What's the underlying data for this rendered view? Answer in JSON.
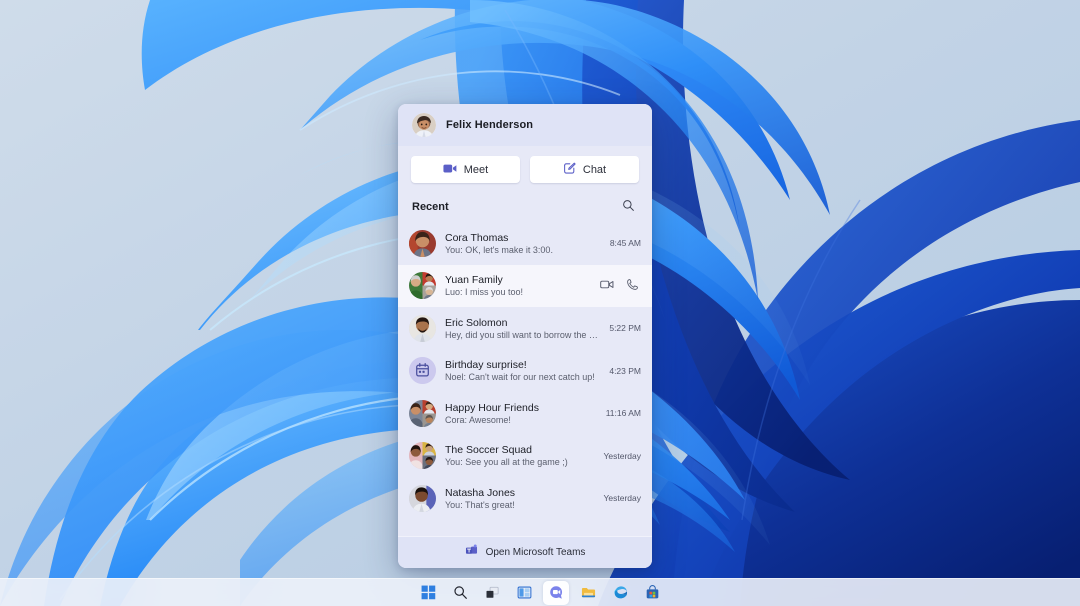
{
  "desktop": {
    "wallpaper_name": "windows-11-bloom-wallpaper",
    "colors": {
      "background_top": "#c9d9e8",
      "background_bottom": "#b9cee3",
      "ribbon_light_blue": "#3fa0fb",
      "ribbon_mid_blue": "#1a72ef",
      "ribbon_deep_blue": "#0b46c8",
      "ribbon_navy": "#0a2f9e"
    }
  },
  "taskbar": {
    "background": "#ecf1f9",
    "items": [
      {
        "name": "start-button",
        "icon": "windows-logo-icon",
        "label": "Start",
        "active": false
      },
      {
        "name": "search-button",
        "icon": "search-icon",
        "label": "Search",
        "active": false
      },
      {
        "name": "task-view-button",
        "icon": "task-view-icon",
        "label": "Task View",
        "active": false
      },
      {
        "name": "widgets-button",
        "icon": "widgets-icon",
        "label": "Widgets",
        "active": false
      },
      {
        "name": "chat-button",
        "icon": "chat-bubble-icon",
        "label": "Chat",
        "active": true
      },
      {
        "name": "file-explorer-button",
        "icon": "folder-icon",
        "label": "File Explorer",
        "active": false
      },
      {
        "name": "edge-button",
        "icon": "edge-icon",
        "label": "Microsoft Edge",
        "active": false
      },
      {
        "name": "microsoft-store-button",
        "icon": "store-bag-icon",
        "label": "Microsoft Store",
        "active": false
      }
    ]
  },
  "flyout": {
    "header": {
      "user_name": "Felix Henderson",
      "avatar": "felix-henderson-avatar"
    },
    "actions": [
      {
        "name": "meet-button",
        "label": "Meet",
        "icon": "video-camera-filled-icon"
      },
      {
        "name": "chat-button",
        "label": "Chat",
        "icon": "compose-chat-icon"
      }
    ],
    "recent": {
      "label": "Recent",
      "search_icon": "search-icon"
    },
    "chats": [
      {
        "name": "Cora Thomas",
        "preview": "You: OK, let's make it 3:00.",
        "time": "8:45 AM",
        "avatar_type": "photo-single",
        "hovered": false,
        "actions": []
      },
      {
        "name": "Yuan Family",
        "preview": "Luo: I miss you too!",
        "time": "",
        "avatar_type": "photo-group",
        "hovered": true,
        "actions": [
          {
            "name": "video-call-button",
            "icon": "video-camera-outline-icon"
          },
          {
            "name": "audio-call-button",
            "icon": "phone-icon"
          }
        ]
      },
      {
        "name": "Eric Solomon",
        "preview": "Hey, did you still want to borrow the notes?",
        "time": "5:22 PM",
        "avatar_type": "photo-single",
        "hovered": false,
        "actions": []
      },
      {
        "name": "Birthday surprise!",
        "preview": "Noel: Can't wait for our next catch up!",
        "time": "4:23 PM",
        "avatar_type": "calendar-icon",
        "hovered": false,
        "actions": []
      },
      {
        "name": "Happy Hour Friends",
        "preview": "Cora: Awesome!",
        "time": "11:16 AM",
        "avatar_type": "photo-group",
        "hovered": false,
        "actions": []
      },
      {
        "name": "The Soccer Squad",
        "preview": "You: See you all at the game ;)",
        "time": "Yesterday",
        "avatar_type": "photo-group",
        "hovered": false,
        "actions": []
      },
      {
        "name": "Natasha Jones",
        "preview": "You: That's great!",
        "time": "Yesterday",
        "avatar_type": "photo-single",
        "hovered": false,
        "actions": []
      }
    ],
    "footer": {
      "label": "Open Microsoft Teams",
      "icon": "microsoft-teams-icon"
    },
    "colors": {
      "panel_background": "#e7e9f7",
      "header_background": "#dfe3f6",
      "hover_row": "#f6f6fc",
      "accent_purple": "#5b5fc7",
      "button_white": "#ffffff"
    }
  }
}
